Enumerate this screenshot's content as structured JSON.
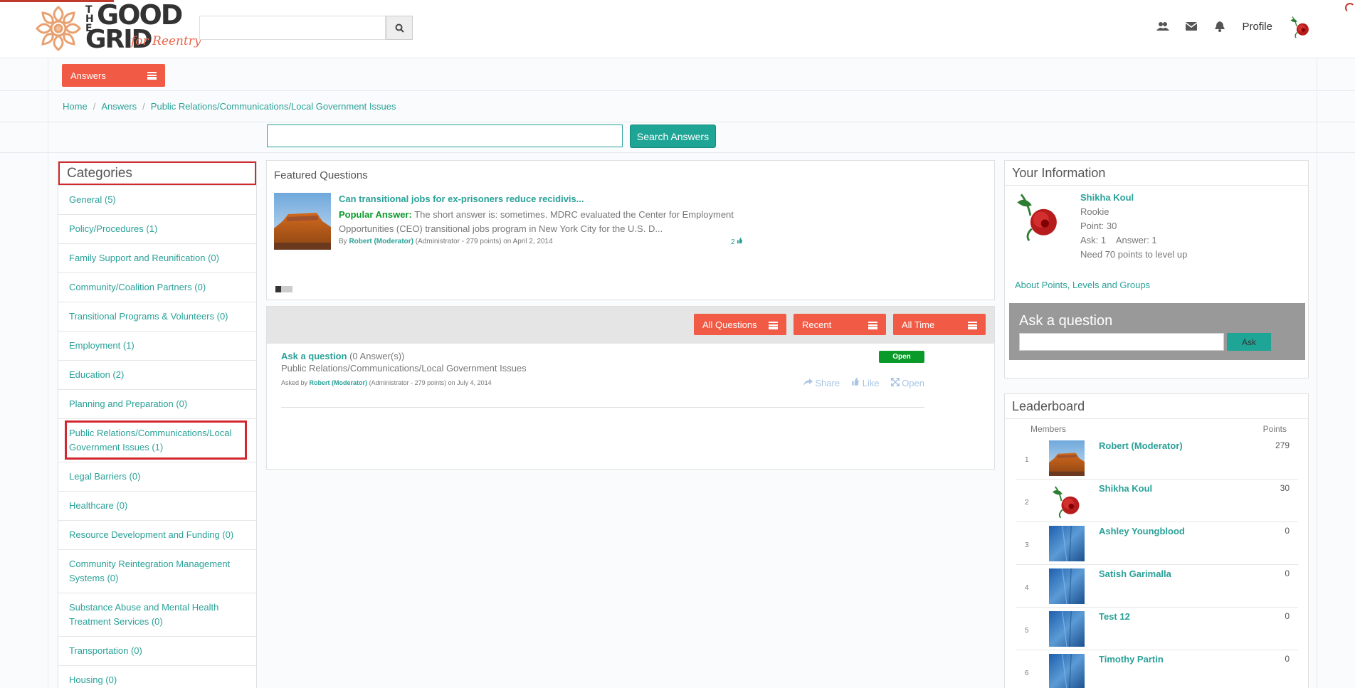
{
  "brand": {
    "the": "THE",
    "good": "GOOD",
    "grid": "GRID",
    "tagline": "for Reentry"
  },
  "header": {
    "search_placeholder": "",
    "profile_label": "Profile",
    "icons": [
      "users-icon",
      "envelope-icon",
      "bell-icon"
    ]
  },
  "menu": {
    "label": "Answers"
  },
  "breadcrumb": [
    "Home",
    "Answers",
    "Public Relations/Communications/Local Government Issues"
  ],
  "answers_search": {
    "value": "",
    "button_label": "Search Answers"
  },
  "categories": {
    "title": "Categories",
    "items": [
      "General (5)",
      "Policy/Procedures (1)",
      "Family Support and Reunification (0)",
      "Community/Coalition Partners (0)",
      "Transitional Programs & Volunteers (0)",
      "Employment (1)",
      "Education (2)",
      "Planning and Preparation (0)",
      "Public Relations/Communications/Local Government Issues (1)",
      "Legal Barriers (0)",
      "Healthcare (0)",
      "Resource Development and Funding (0)",
      "Community Reintegration Management Systems (0)",
      "Substance Abuse and Mental Health Treatment Services (0)",
      "Transportation (0)",
      "Housing (0)"
    ]
  },
  "featured": {
    "title": "Featured Questions",
    "question": "Can transitional jobs for ex-prisoners reduce recidivis...",
    "popular_label": "Popular Answer:",
    "answer": "The short answer is: sometimes. MDRC evaluated the Center for Employment Opportunities (CEO) transitional jobs program in New York City for the U.S. D...",
    "by": "By",
    "author": "Robert (Moderator)",
    "author_meta": "(Administrator - 279 points)",
    "date": "on April 2, 2014",
    "likes": "2"
  },
  "filters": {
    "all": "All Questions",
    "recent": "Recent",
    "time": "All Time"
  },
  "question_item": {
    "title": "Ask a question",
    "answers": "(0 Answer(s))",
    "category": "Public Relations/Communications/Local Government Issues",
    "asked_by": "Asked by",
    "author": "Robert (Moderator)",
    "meta": "(Administrator - 279 points) on July 4, 2014",
    "status": "Open",
    "share": "Share",
    "like": "Like",
    "open": "Open"
  },
  "your_info": {
    "title": "Your Information",
    "name": "Shikha Koul",
    "level": "Rookie",
    "points": "Point: 30",
    "ask": "Ask: 1",
    "answer": "Answer: 1",
    "next": "Need 70 points to level up",
    "link": "About Points, Levels and Groups",
    "ask_title": "Ask a question",
    "ask_button": "Ask"
  },
  "leaderboard": {
    "title": "Leaderboard",
    "col_members": "Members",
    "col_points": "Points",
    "rows": [
      {
        "rank": "1",
        "name": "Robert (Moderator)",
        "points": "279",
        "avatar": "canyon"
      },
      {
        "rank": "2",
        "name": "Shikha Koul",
        "points": "30",
        "avatar": "rose"
      },
      {
        "rank": "3",
        "name": "Ashley Youngblood",
        "points": "0",
        "avatar": "blue"
      },
      {
        "rank": "4",
        "name": "Satish Garimalla",
        "points": "0",
        "avatar": "blue"
      },
      {
        "rank": "5",
        "name": "Test 12",
        "points": "0",
        "avatar": "blue"
      },
      {
        "rank": "6",
        "name": "Timothy Partin",
        "points": "0",
        "avatar": "blue"
      }
    ]
  },
  "colors": {
    "accent": "#f15a45",
    "teal": "#2aa198",
    "open_green": "#0a9a2a",
    "highlight_red": "#d0282e"
  }
}
